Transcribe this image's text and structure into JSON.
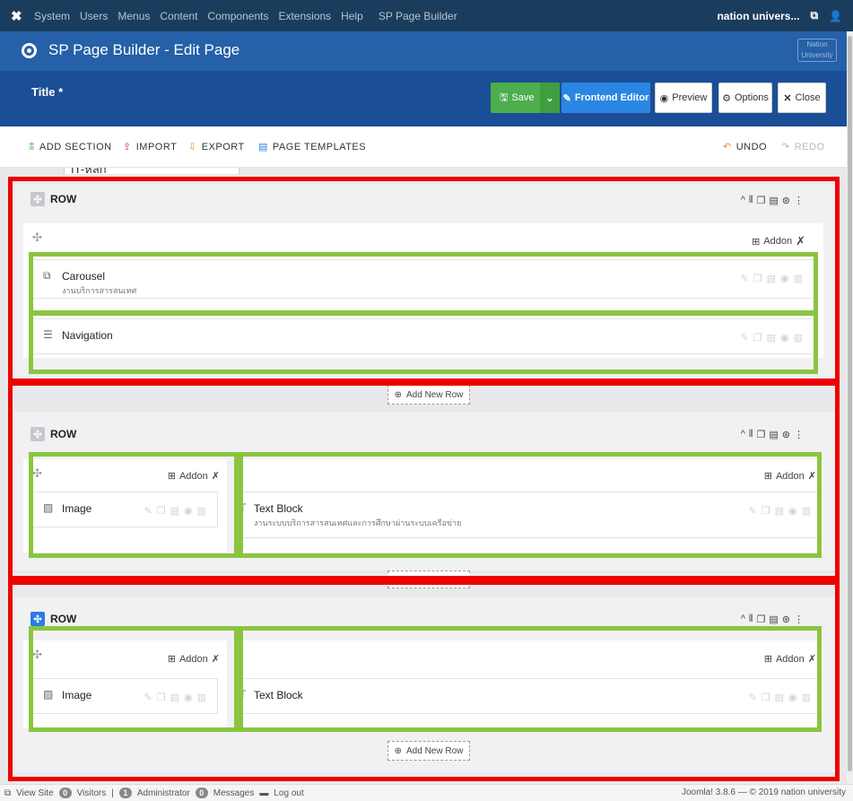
{
  "topbar": {
    "menu": [
      "System",
      "Users",
      "Menus",
      "Content",
      "Components",
      "Extensions",
      "Help",
      "SP Page Builder"
    ],
    "site_name": "nation univers...",
    "logo_icon": "joomla-icon"
  },
  "titlebar": {
    "title": "SP Page Builder - Edit Page",
    "brand_text": "Nation University"
  },
  "editbar": {
    "title_label": "Title *",
    "title_value": "IT-หลัก",
    "save_label": "Save",
    "frontend_label": "Frontend Editor",
    "preview_label": "Preview",
    "options_label": "Options",
    "close_label": "Close"
  },
  "toolbar2": {
    "add_section": "ADD SECTION",
    "import": "IMPORT",
    "export": "EXPORT",
    "page_templates": "PAGE TEMPLATES",
    "undo": "UNDO",
    "redo": "REDO"
  },
  "builder": {
    "row_label": "ROW",
    "addon_label": "Addon",
    "add_new_row": "Add New Row",
    "rows": [
      {
        "addons": [
          {
            "name": "Carousel",
            "subtitle": "งานบริการสารสนเทศ"
          },
          {
            "name": "Navigation",
            "subtitle": ""
          }
        ]
      },
      {
        "columns": [
          {
            "addons": [
              {
                "name": "Image",
                "subtitle": ""
              }
            ]
          },
          {
            "addons": [
              {
                "name": "Text Block",
                "subtitle": "งานระบบบริการสารสนเทศและการศึกษาผ่านระบบเครือข่าย"
              }
            ]
          }
        ]
      },
      {
        "columns": [
          {
            "addons": [
              {
                "name": "Image",
                "subtitle": ""
              }
            ]
          },
          {
            "addons": [
              {
                "name": "Text Block",
                "subtitle": ""
              }
            ]
          }
        ]
      }
    ]
  },
  "footer": {
    "view_site": "View Site",
    "visitors_count": "0",
    "visitors": "Visitors",
    "admin_count": "1",
    "administrator": "Administrator",
    "messages_count": "0",
    "messages": "Messages",
    "logout": "Log out",
    "version": "Joomla! 3.8.6 — © 2019 nation university"
  },
  "colors": {
    "topbar": "#1b3d5d",
    "titlebar": "#2560a8",
    "editbar": "#1a4e96",
    "save_green": "#4cae4c",
    "frontend_blue": "#2a86e2",
    "annotation_red": "#ee0000",
    "annotation_green": "#8bc540"
  }
}
